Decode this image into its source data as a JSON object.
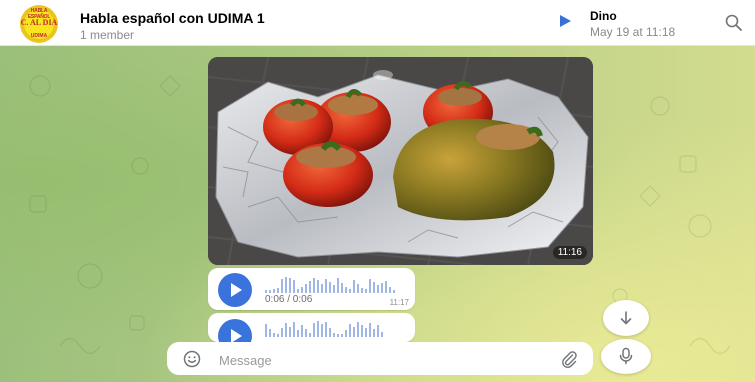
{
  "header": {
    "chat_title": "Habla español con UDIMA 1",
    "chat_subtitle": "1 member",
    "avatar": {
      "text_top": "HABLA ESPAÑOL",
      "text_main": "C. AL DIA",
      "text_bottom": "UDIMA"
    },
    "pinned": {
      "icon": "play-icon",
      "name": "Dino",
      "date": "May 19 at 11:18"
    },
    "search_icon": "search-icon"
  },
  "messages": {
    "photo": {
      "time": "11:16"
    },
    "voice": [
      {
        "progress": "0:06 / 0:06",
        "time": "11:17"
      },
      {
        "progress": "",
        "time": ""
      }
    ]
  },
  "composer": {
    "placeholder": "Message",
    "emoji_icon": "smile-icon",
    "attach_icon": "paperclip-icon",
    "mic_icon": "microphone-icon",
    "scroll_icon": "arrow-down-icon"
  },
  "colors": {
    "accent": "#3b73dd",
    "background_green": "#b4cd85",
    "background_yellow": "#e6e696"
  }
}
